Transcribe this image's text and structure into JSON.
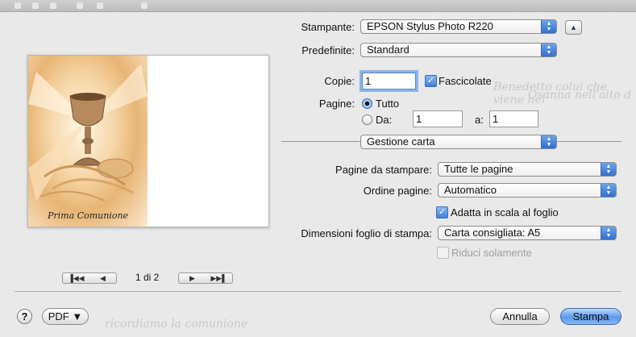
{
  "printer": {
    "label": "Stampante:",
    "value": "EPSON Stylus Photo R220"
  },
  "presets": {
    "label": "Predefinite:",
    "value": "Standard"
  },
  "copies": {
    "label": "Copie:",
    "value": "1",
    "collate_label": "Fascicolate"
  },
  "pages": {
    "label": "Pagine:",
    "all_label": "Tutto",
    "from_label": "Da:",
    "from_value": "1",
    "to_label": "a:",
    "to_value": "1"
  },
  "section": {
    "value": "Gestione carta"
  },
  "pages_to_print": {
    "label": "Pagine da stampare:",
    "value": "Tutte le pagine"
  },
  "page_order": {
    "label": "Ordine pagine:",
    "value": "Automatico"
  },
  "scale_to_fit": {
    "label": "Adatta in scala al foglio"
  },
  "paper_size": {
    "label": "Dimensioni foglio di stampa:",
    "value": "Carta consigliata: A5"
  },
  "reduce_only": {
    "label": "Riduci solamente"
  },
  "preview": {
    "caption": "Prima Comunione",
    "page_indicator": "1 di 2"
  },
  "buttons": {
    "help": "?",
    "pdf": "PDF ▼",
    "cancel": "Annulla",
    "print": "Stampa"
  },
  "background_doc": {
    "line1": "Benedetto colui che viene nel",
    "line2": "Osanna nell'alto d",
    "line3": "ricordiamo la comunione"
  },
  "colors": {
    "accent": "#3f7fda",
    "window_bg": "#e9e9e9"
  }
}
